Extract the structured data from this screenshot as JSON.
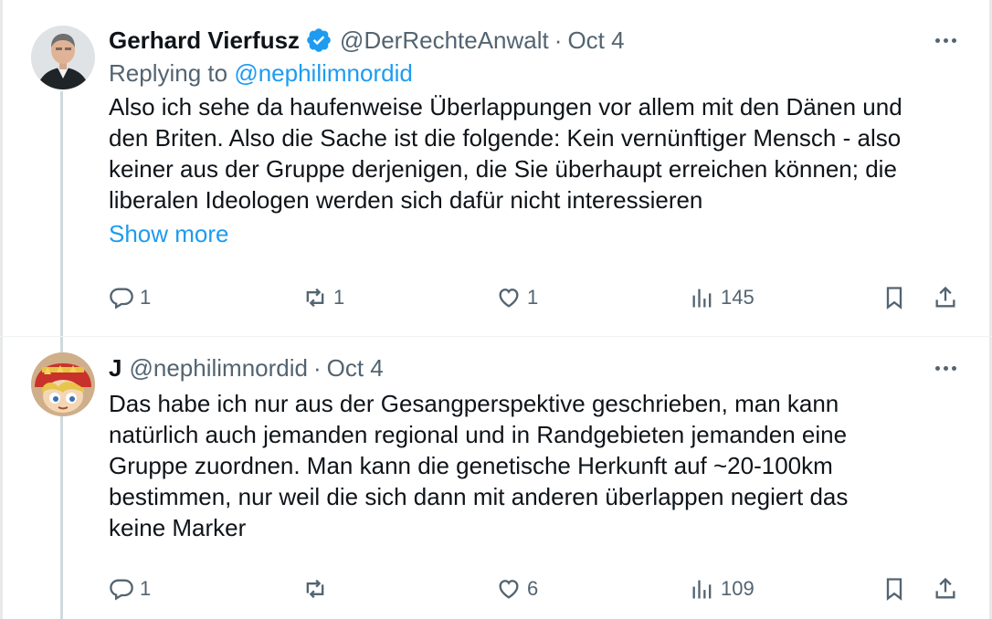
{
  "tweets": [
    {
      "name": "Gerhard Vierfusz",
      "verified": true,
      "handle": "@DerRechteAnwalt",
      "separator": "·",
      "date": "Oct 4",
      "replying_prefix": "Replying to",
      "replying_to": "@nephilimnordid",
      "text_lines": [
        "Also ich sehe da haufenweise Überlappungen vor allem mit den Dänen und",
        "den Briten. Also die Sache ist die folgende: Kein vernünftiger Mensch - also",
        "keiner aus der Gruppe derjenigen, die Sie überhaupt erreichen können; die",
        "liberalen Ideologen werden sich dafür nicht interessieren"
      ],
      "show_more": "Show more",
      "replies": "1",
      "reposts": "1",
      "likes": "1",
      "views": "145"
    },
    {
      "name": "J",
      "verified": false,
      "handle": "@nephilimnordid",
      "separator": "·",
      "date": "Oct 4",
      "text_lines": [
        "Das habe ich nur aus der Gesangperspektive geschrieben, man kann",
        "natürlich auch jemanden regional und in Randgebieten jemanden eine",
        "Gruppe zuordnen. Man kann die genetische Herkunft auf ~20-100km",
        "bestimmen, nur weil die sich dann mit anderen überlappen negiert das",
        "keine Marker"
      ],
      "replies": "1",
      "reposts": "",
      "likes": "6",
      "views": "109"
    }
  ],
  "icons": {
    "verified": "verified-badge-icon",
    "reply": "reply-icon",
    "repost": "repost-icon",
    "like": "heart-icon",
    "views": "views-chart-icon",
    "bookmark": "bookmark-icon",
    "share": "share-icon",
    "more": "more-dots-icon"
  },
  "colors": {
    "accent": "#1d9bf0",
    "secondary_text": "#536471",
    "primary_text": "#0f1419",
    "thread_line": "#cfd9de"
  }
}
